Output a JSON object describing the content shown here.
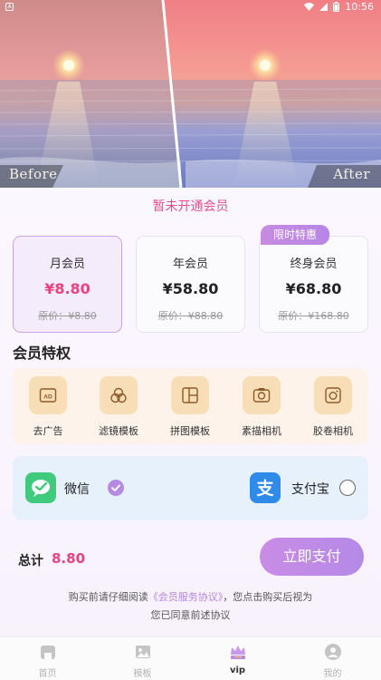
{
  "status_bar": {
    "time": "10:56"
  },
  "hero": {
    "before_label": "Before",
    "after_label": "After"
  },
  "membership_status": "暂未开通会员",
  "plans": [
    {
      "name": "月会员",
      "price": "¥8.80",
      "original": "原价：¥8.80"
    },
    {
      "name": "年会员",
      "price": "¥58.80",
      "original": "原价：¥88.80"
    },
    {
      "name": "终身会员",
      "price": "¥68.80",
      "original": "原价：¥168.80"
    }
  ],
  "limited_badge": "限时特惠",
  "privileges": {
    "title": "会员特权",
    "items": [
      {
        "label": "去广告",
        "icon": "ad-icon"
      },
      {
        "label": "滤镜模板",
        "icon": "filter-icon"
      },
      {
        "label": "拼图模板",
        "icon": "collage-icon"
      },
      {
        "label": "素描相机",
        "icon": "sketch-camera-icon"
      },
      {
        "label": "胶卷相机",
        "icon": "film-camera-icon"
      }
    ]
  },
  "payment": {
    "wechat_label": "微信",
    "alipay_label": "支付宝",
    "selected": "wechat"
  },
  "total": {
    "label": "总计",
    "value": "8.80"
  },
  "pay_button": "立即支付",
  "agreement": {
    "prefix": "购买前请仔细阅读",
    "link": "《会员服务协议》",
    "suffix": "，您点击购买后视为",
    "line2": "您已同意前述协议"
  },
  "nav": [
    {
      "label": "首页",
      "icon": "home-icon"
    },
    {
      "label": "模板",
      "icon": "template-icon"
    },
    {
      "label": "vip",
      "icon": "crown-icon"
    },
    {
      "label": "我的",
      "icon": "profile-icon"
    }
  ],
  "colors": {
    "accent": "#b98ae4",
    "price": "#e8437e",
    "wechat": "#3fca7d",
    "alipay": "#2f8be9"
  }
}
